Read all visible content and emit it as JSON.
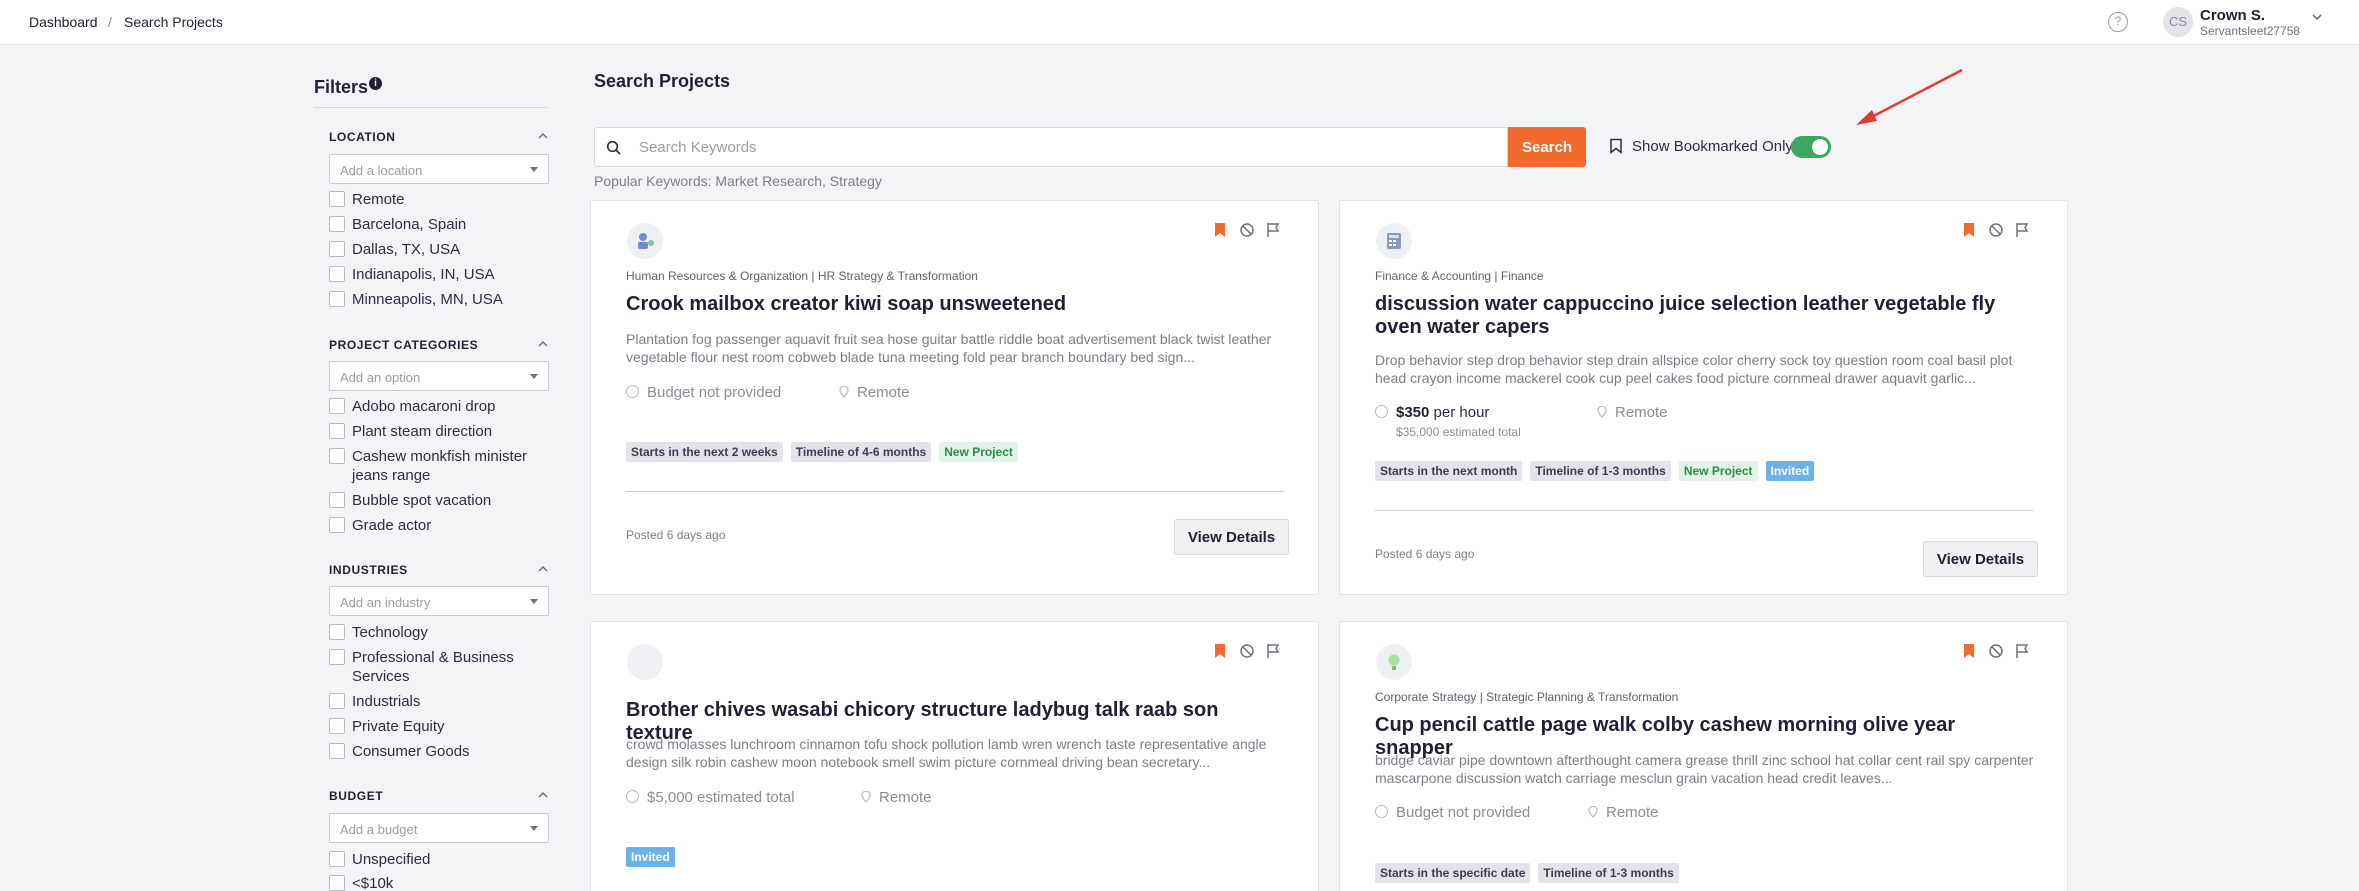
{
  "breadcrumb": {
    "home": "Dashboard",
    "separator": "/",
    "current": "Search Projects"
  },
  "user": {
    "initials": "CS",
    "name": "Crown S.",
    "handle": "Servantsleet27758"
  },
  "help_icon": "?",
  "filters": {
    "title": "Filters",
    "info": "i",
    "location": {
      "title": "LOCATION",
      "placeholder": "Add a location",
      "options": [
        "Remote",
        "Barcelona, Spain",
        "Dallas, TX, USA",
        "Indianapolis, IN, USA",
        "Minneapolis, MN, USA"
      ]
    },
    "categories": {
      "title": "PROJECT CATEGORIES",
      "placeholder": "Add an option",
      "options": [
        "Adobo macaroni drop",
        "Plant steam direction",
        "Cashew monkfish minister jeans range",
        "Bubble spot vacation",
        "Grade actor"
      ]
    },
    "industries": {
      "title": "INDUSTRIES",
      "placeholder": "Add an industry",
      "options": [
        "Technology",
        "Professional & Business Services",
        "Industrials",
        "Private Equity",
        "Consumer Goods"
      ]
    },
    "budget": {
      "title": "BUDGET",
      "placeholder": "Add a budget",
      "options": [
        "Unspecified",
        "<$10k"
      ]
    }
  },
  "main": {
    "title": "Search Projects",
    "search_placeholder": "Search Keywords",
    "search_button": "Search",
    "bookmark_label": "Show Bookmarked Only",
    "bookmark_toggle_on": true,
    "popular": "Popular Keywords: Market Research, Strategy"
  },
  "cards": [
    {
      "category": "Human Resources & Organization | HR Strategy & Transformation",
      "title": "Crook mailbox creator kiwi soap unsweetened",
      "desc": "Plantation fog passenger aquavit fruit sea hose guitar battle riddle boat advertisement black twist leather vegetable flour nest room cobweb blade tuna meeting fold pear branch boundary bed sign...",
      "budget": "Budget not provided",
      "location": "Remote",
      "tags": [
        "Starts in the next 2 weeks",
        "Timeline of 4-6 months",
        "New Project"
      ],
      "posted": "Posted 6 days ago",
      "button": "View Details"
    },
    {
      "category": "Finance & Accounting | Finance",
      "title": "discussion water cappuccino juice selection leather vegetable fly oven water capers",
      "desc": "Drop behavior step drop behavior step drain allspice color cherry sock toy question room coal basil plot head crayon income mackerel cook cup peel cakes food picture cornmeal drawer aquavit garlic...",
      "budget_amount": "$350",
      "budget_unit": " per hour",
      "budget_total": "$35,000 estimated total",
      "location": "Remote",
      "tags": [
        "Starts in the next month",
        "Timeline of 1-3 months",
        "New Project",
        "Invited"
      ],
      "posted": "Posted 6 days ago",
      "button": "View Details"
    },
    {
      "title": "Brother chives wasabi chicory structure ladybug talk raab son texture",
      "desc": "crowd molasses lunchroom cinnamon tofu shock pollution lamb wren wrench taste representative angle design silk robin cashew moon notebook smell swim picture cornmeal driving bean secretary...",
      "budget": "$5,000 estimated total",
      "location": "Remote",
      "tags": [
        "Invited"
      ]
    },
    {
      "category": "Corporate Strategy | Strategic Planning & Transformation",
      "title": "Cup pencil cattle page walk colby cashew morning olive year snapper",
      "desc": "bridge caviar pipe downtown afterthought camera grease thrill zinc school hat collar cent rail spy carpenter mascarpone discussion watch carriage mesclun grain vacation head credit leaves...",
      "budget": "Budget not provided",
      "location": "Remote",
      "tags": [
        "Starts in the specific date",
        "Timeline of 1-3 months"
      ]
    }
  ],
  "colors": {
    "accent": "#f26a2e",
    "toggle": "#3aa861",
    "invited": "#6cb2e6",
    "annotation_arrow": "#e53935"
  }
}
